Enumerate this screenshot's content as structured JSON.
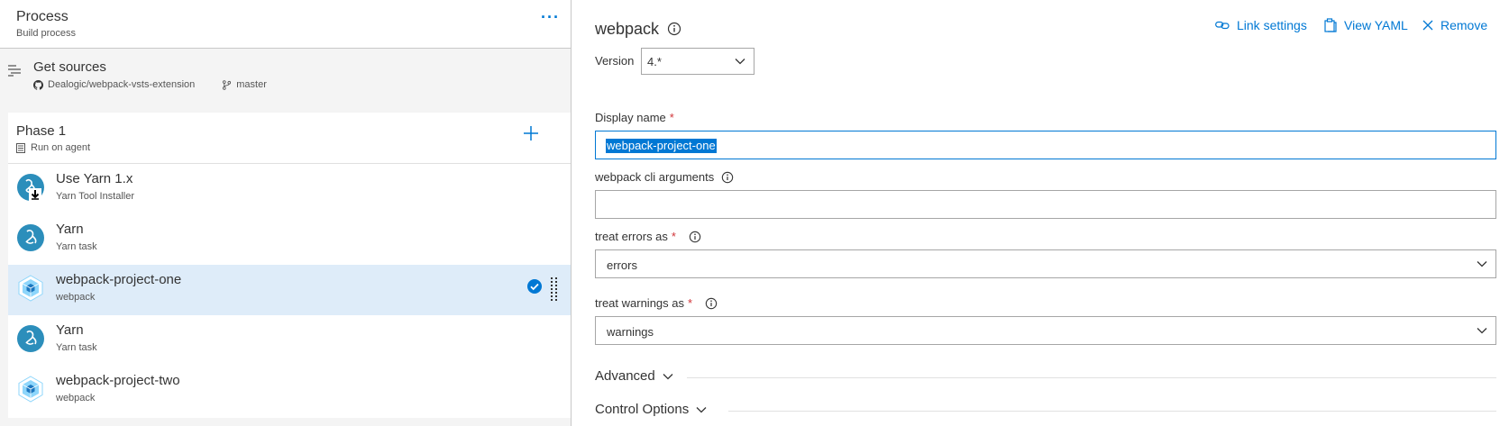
{
  "process": {
    "title": "Process",
    "subtitle": "Build process",
    "more_label": "···"
  },
  "sources": {
    "title": "Get sources",
    "repo": "Dealogic/webpack-vsts-extension",
    "branch": "master"
  },
  "phase": {
    "title": "Phase 1",
    "subtitle": "Run on agent"
  },
  "tasks": [
    {
      "title": "Use Yarn 1.x",
      "subtitle": "Yarn Tool Installer",
      "icon": "yarn-installer-icon",
      "selected": false
    },
    {
      "title": "Yarn",
      "subtitle": "Yarn task",
      "icon": "yarn-icon",
      "selected": false
    },
    {
      "title": "webpack-project-one",
      "subtitle": "webpack",
      "icon": "webpack-icon",
      "selected": true
    },
    {
      "title": "Yarn",
      "subtitle": "Yarn task",
      "icon": "yarn-icon",
      "selected": false
    },
    {
      "title": "webpack-project-two",
      "subtitle": "webpack",
      "icon": "webpack-icon",
      "selected": false
    }
  ],
  "detail": {
    "task_name": "webpack",
    "actions": {
      "link_settings": "Link settings",
      "view_yaml": "View YAML",
      "remove": "Remove"
    },
    "version": {
      "label": "Version",
      "value": "4.*"
    },
    "display_name": {
      "label": "Display name",
      "required": "*",
      "value": "webpack-project-one"
    },
    "cli_args": {
      "label": "webpack cli arguments",
      "value": ""
    },
    "errors": {
      "label": "treat errors as",
      "required": "*",
      "value": "errors"
    },
    "warnings": {
      "label": "treat warnings as",
      "required": "*",
      "value": "warnings"
    },
    "advanced": "Advanced",
    "control_options": "Control Options"
  },
  "colors": {
    "accent": "#0078d4",
    "selected_row": "#deecf9",
    "required": "#d13438",
    "panel_gray": "#f4f4f4"
  }
}
